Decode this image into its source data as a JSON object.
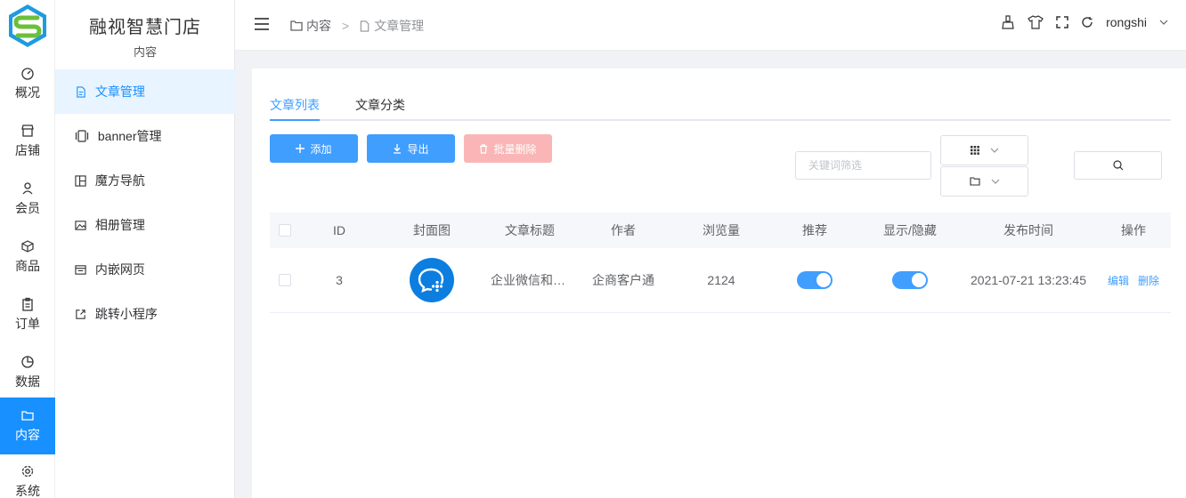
{
  "app": {
    "brand": "融视智慧门店",
    "section": "内容"
  },
  "rail": [
    {
      "label": "概况",
      "icon": "dashboard-icon"
    },
    {
      "label": "店铺",
      "icon": "shop-icon"
    },
    {
      "label": "会员",
      "icon": "user-icon"
    },
    {
      "label": "商品",
      "icon": "box-icon"
    },
    {
      "label": "订单",
      "icon": "clipboard-icon"
    },
    {
      "label": "数据",
      "icon": "pie-chart-icon"
    },
    {
      "label": "内容",
      "icon": "folder-icon",
      "active": true
    },
    {
      "label": "系统",
      "icon": "gear-icon"
    }
  ],
  "submenu": [
    {
      "label": "文章管理",
      "icon": "document-icon",
      "active": true
    },
    {
      "label": "banner管理",
      "icon": "banner-icon"
    },
    {
      "label": "魔方导航",
      "icon": "grid-nav-icon"
    },
    {
      "label": "相册管理",
      "icon": "image-icon"
    },
    {
      "label": "内嵌网页",
      "icon": "webpage-icon"
    },
    {
      "label": "跳转小程序",
      "icon": "external-link-icon"
    }
  ],
  "breadcrumb": {
    "root": "内容",
    "separator": ">",
    "current": "文章管理"
  },
  "header": {
    "username": "rongshi"
  },
  "tabs": [
    "文章列表",
    "文章分类"
  ],
  "toolbar": {
    "add": "添加",
    "export": "导出",
    "batch_delete": "批量删除",
    "keyword_placeholder": "关键词筛选"
  },
  "table": {
    "columns": [
      "ID",
      "封面图",
      "文章标题",
      "作者",
      "浏览量",
      "推荐",
      "显示/隐藏",
      "发布时间",
      "操作"
    ],
    "rows": [
      {
        "id": "3",
        "title": "企业微信和企商客户通",
        "author": "企商客户通",
        "views": "2124",
        "recommended": true,
        "visible": true,
        "published": "2021-07-21 13:23:45",
        "edit": "编辑",
        "delete": "删除"
      }
    ]
  },
  "colors": {
    "primary": "#409eff",
    "active_rail": "#1890ff",
    "danger_disabled": "#fab6b6"
  }
}
